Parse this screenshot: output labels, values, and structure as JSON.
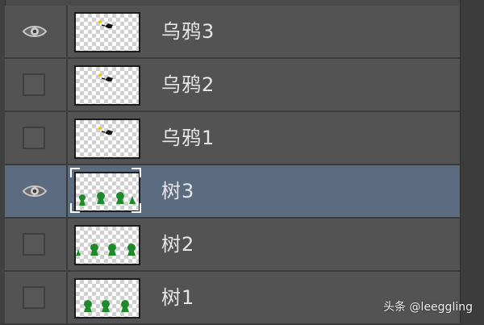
{
  "layers_panel": {
    "layers": [
      {
        "name": "乌鸦3",
        "visible": true,
        "selected": false,
        "content": "crow"
      },
      {
        "name": "乌鸦2",
        "visible": false,
        "selected": false,
        "content": "crow"
      },
      {
        "name": "乌鸦1",
        "visible": false,
        "selected": false,
        "content": "crow"
      },
      {
        "name": "树3",
        "visible": true,
        "selected": true,
        "content": "trees"
      },
      {
        "name": "树2",
        "visible": false,
        "selected": false,
        "content": "trees"
      },
      {
        "name": "树1",
        "visible": false,
        "selected": false,
        "content": "trees"
      }
    ]
  },
  "icons": {
    "visibility_on": "eye-icon",
    "visibility_off": "empty-visibility-box"
  },
  "colors": {
    "panel_bg": "#535353",
    "selected_row": "#5b6b80",
    "tree_green": "#1e8a2a"
  },
  "watermark": "头条 @leeggling"
}
